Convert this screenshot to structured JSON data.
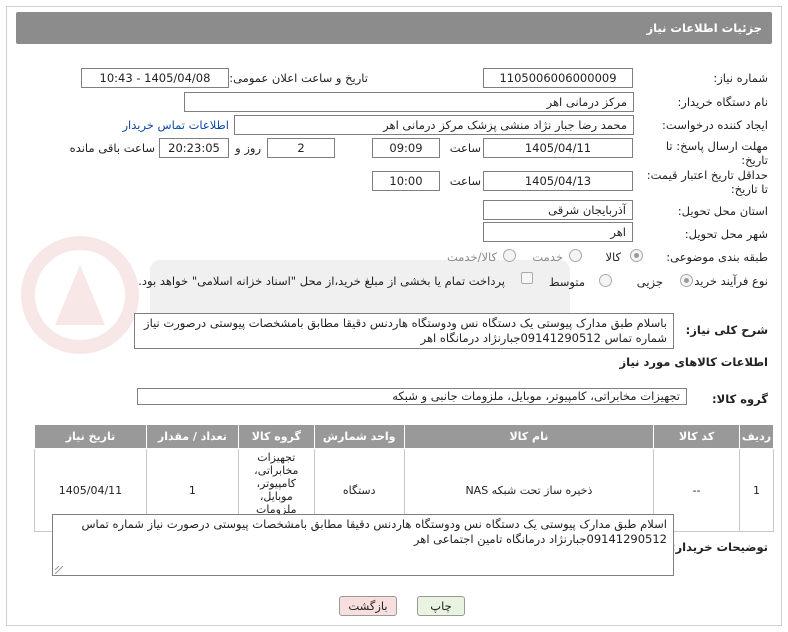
{
  "header": {
    "title": "جزئیات اطلاعات نیاز"
  },
  "fields": {
    "need_number": {
      "label": "شماره نیاز:",
      "value": "1105006006000009"
    },
    "announce": {
      "label": "تاریخ و ساعت اعلان عمومی:",
      "value": "1405/04/08 - 10:43"
    },
    "buyer_org": {
      "label": "نام دستگاه خریدار:",
      "value": "مرکز درمانی اهر"
    },
    "creator": {
      "label": "ایجاد کننده درخواست:",
      "value": "محمد رضا  جبار نژاد منشی پزشک  مرکز درمانی اهر",
      "link": "اطلاعات تماس خریدار"
    },
    "deadline": {
      "label_line1": "مهلت ارسال پاسخ: تا",
      "label_line2": "تاریخ:",
      "date": "1405/04/11",
      "time_label": "ساعت",
      "time": "09:09",
      "days": "2",
      "days_label": "روز و",
      "remaining": "20:23:05",
      "remaining_label": "ساعت باقی مانده"
    },
    "price_validity": {
      "label_line1": "حداقل تاریخ اعتبار قیمت:",
      "label_line2": "تا تاریخ:",
      "date": "1405/04/13",
      "time_label": "ساعت",
      "time": "10:00"
    },
    "province": {
      "label": "استان محل تحویل:",
      "value": "آذربایجان شرقی"
    },
    "city": {
      "label": "شهر محل تحویل:",
      "value": "اهر"
    },
    "category": {
      "label": "طبقه بندی موضوعی:",
      "options": [
        "کالا",
        "خدمت",
        "کالا/خدمت"
      ],
      "selected": "کالا"
    },
    "purchase_type": {
      "label": "نوع فرآیند خرید :",
      "options": [
        "جزیی",
        "متوسط"
      ],
      "selected": "جزیی",
      "payment_note": "پرداخت تمام یا بخشی از مبلغ خرید،از محل \"اسناد خزانه اسلامی\" خواهد بود."
    }
  },
  "description": {
    "label": "شرح کلی نیاز:",
    "value": "باسلام طبق مدارک پیوستی یک دستگاه نس ودوستگاه هاردنس  دقیقا مطابق بامشخصات پیوستی درصورت نیاز شماره تماس 09141290512جبارنژاد درمانگاه  اهر"
  },
  "goods_info": {
    "title": "اطلاعات کالاهای مورد نیاز",
    "group_label": "گروه کالا:",
    "group_value": "تجهیزات مخابراتی، کامپیوتر، موبایل، ملزومات جانبی و شبکه"
  },
  "table": {
    "headers": [
      "ردیف",
      "کد کالا",
      "نام کالا",
      "واحد شمارش",
      "گروه کالا",
      "تعداد / مقدار",
      "تاریخ نیاز"
    ],
    "rows": [
      [
        "1",
        "--",
        "ذخیره ساز تحت شبکه NAS",
        "دستگاه",
        "تجهیزات مخابراتی، کامپیوتر، موبایل، ملزومات جانبی و شبکه",
        "1",
        "1405/04/11"
      ]
    ]
  },
  "buyer_notes": {
    "label": "توضیحات خریدار:",
    "value": "اسلام طبق مدارک پیوستی یک دستگاه نس ودوستگاه هاردنس  دقیقا مطابق بامشخصات پیوستی درصورت نیاز شماره تماس 09141290512جبارنژاد درمانگاه تامین اجتماعی اهر"
  },
  "buttons": {
    "print": "چاپ",
    "back": "بازگشت"
  },
  "colors": {
    "header_bg": "#8c8c8c",
    "table_header_bg": "#999999",
    "link": "#0b4aa8",
    "back_button_bg": "#f9dede",
    "print_button_bg": "#e8f4e0"
  }
}
